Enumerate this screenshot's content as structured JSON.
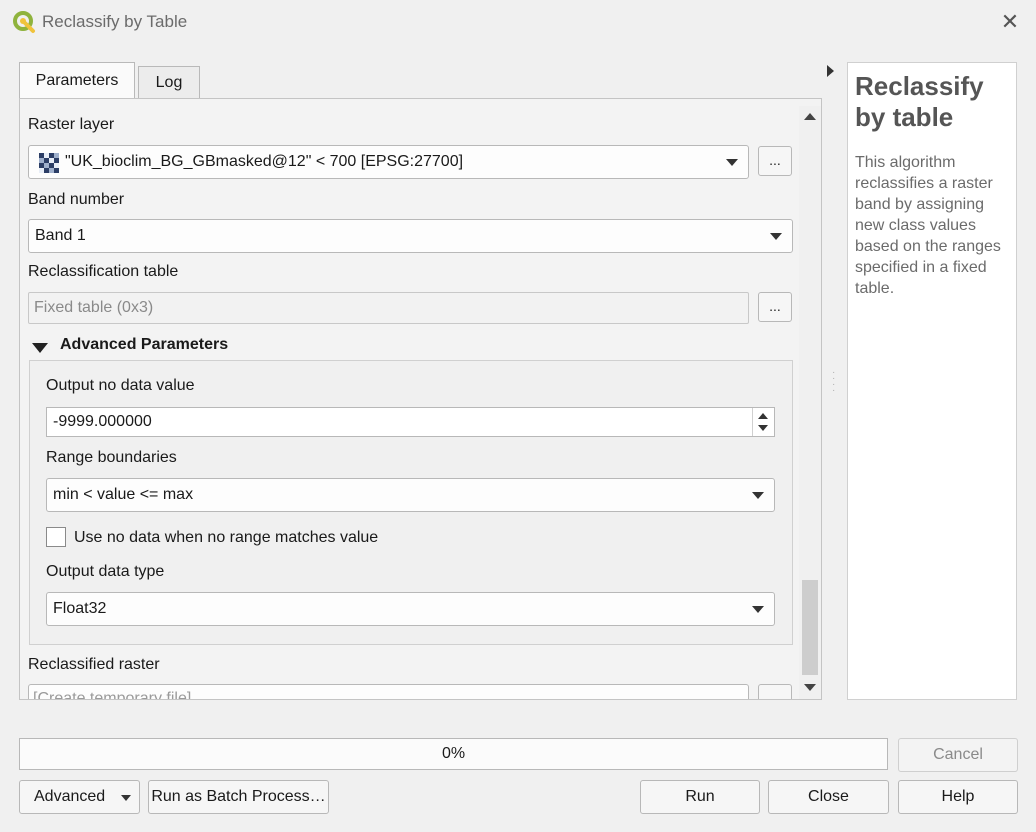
{
  "window": {
    "title": "Reclassify by Table",
    "close_icon": "close-icon",
    "app_icon": "qgis-logo-icon"
  },
  "tabs": [
    {
      "label": "Parameters",
      "active": true
    },
    {
      "label": "Log",
      "active": false
    }
  ],
  "parameters": {
    "raster_layer": {
      "label": "Raster layer",
      "value": "\"UK_bioclim_BG_GBmasked@12\" < 700 [EPSG:27700]",
      "icon": "raster-layer-icon",
      "browse_label": "..."
    },
    "band_number": {
      "label": "Band number",
      "value": "Band 1"
    },
    "reclassification_table": {
      "label": "Reclassification table",
      "value": "Fixed table (0x3)",
      "browse_label": "..."
    },
    "advanced": {
      "header": "Advanced Parameters",
      "expanded": true,
      "output_no_data": {
        "label": "Output no data value",
        "value": "-9999.000000"
      },
      "range_boundaries": {
        "label": "Range boundaries",
        "value": "min < value <= max"
      },
      "use_no_data": {
        "label": "Use no data when no range matches value",
        "checked": false
      },
      "output_data_type": {
        "label": "Output data type",
        "value": "Float32"
      }
    },
    "reclassified_raster": {
      "label": "Reclassified raster",
      "placeholder": "[Create temporary file]"
    }
  },
  "help": {
    "title": "Reclassify by table",
    "body": "This algorithm reclassifies a raster band by assigning new class values based on the ranges specified in a fixed table."
  },
  "progress": {
    "value": 0,
    "text": "0%"
  },
  "buttons": {
    "cancel": "Cancel",
    "advanced": "Advanced",
    "batch": "Run as Batch Process…",
    "run": "Run",
    "close": "Close",
    "help": "Help"
  },
  "colors": {
    "window_bg": "#f0f0f0",
    "help_title": "#555555",
    "help_text": "#6b6b6b",
    "qgis_green": "#8fb33d",
    "qgis_yellow": "#f0c33c"
  }
}
